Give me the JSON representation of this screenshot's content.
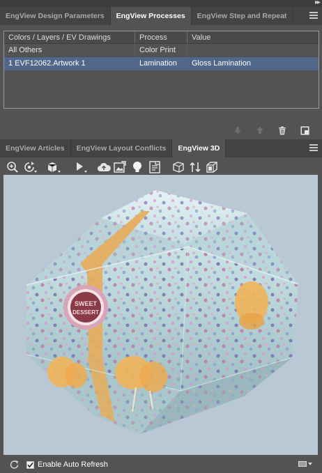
{
  "top_panel": {
    "tabs": [
      {
        "label": "EngView Design Parameters",
        "active": false
      },
      {
        "label": "EngView Processes",
        "active": true
      },
      {
        "label": "EngView Step and Repeat",
        "active": false
      }
    ]
  },
  "processes_table": {
    "columns": [
      "Colors / Layers / EV Drawings",
      "Process",
      "Value"
    ],
    "rows": [
      {
        "name": "All Others",
        "process": "Color Print",
        "value": "",
        "selected": false
      },
      {
        "name": "1 EVF12062.Artwork 1",
        "process": "Lamination",
        "value": "Gloss Lamination",
        "selected": true
      }
    ],
    "actions": [
      "move-down-icon",
      "move-up-icon",
      "trash-icon",
      "new-item-icon"
    ]
  },
  "bottom_panel": {
    "tabs": [
      {
        "label": "EngView Articles",
        "active": false
      },
      {
        "label": "EngView Layout Conflicts",
        "active": false
      },
      {
        "label": "EngView 3D",
        "active": true
      }
    ]
  },
  "toolbar_3d": {
    "tools": [
      "zoom-icon",
      "rotate-icon",
      "cube-view-icon",
      "play-icon",
      "cloud-upload-icon",
      "export-image-icon",
      "light-bulb-icon",
      "document-icon",
      "wireframe-cube-icon",
      "flip-icon",
      "material-cube-icon"
    ]
  },
  "viewport": {
    "background": "#bac7d5",
    "label_text_line1": "SWEET",
    "label_text_line2": "DESSERT"
  },
  "status_bar": {
    "auto_refresh_label": "Enable Auto Refresh",
    "auto_refresh_checked": true
  }
}
